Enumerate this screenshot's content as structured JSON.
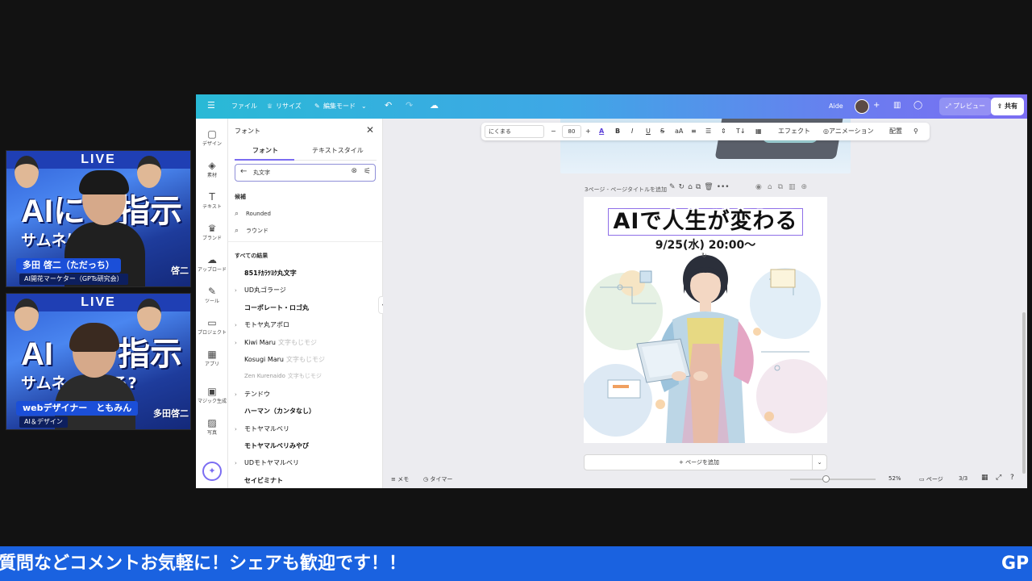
{
  "webcams": [
    {
      "live_label": "LIVE",
      "headline1": "AIに　指示",
      "headline2": "サムネは　なる?",
      "name": "多田 啓二（ただっち）",
      "role": "AI開花マーケター（GPTs研究会）",
      "side_text": "啓二"
    },
    {
      "live_label": "LIVE",
      "headline1": "AI　　指示",
      "headline2": "サムネ　　なる?",
      "name": "webデザイナー　ともみん",
      "role": "AI＆デザイン",
      "side_text": "多田啓二"
    }
  ],
  "canva": {
    "topbar": {
      "menu_icon": "menu-icon",
      "file": "ファイル",
      "resize": "リサイズ",
      "edit_mode": "編集モード",
      "user": "Aide",
      "preview": "プレビュー",
      "share": "共有"
    },
    "rail": [
      {
        "icon": "design-icon",
        "glyph": "▢",
        "label": "デザイン"
      },
      {
        "icon": "elements-icon",
        "glyph": "◈",
        "label": "素材"
      },
      {
        "icon": "text-icon",
        "glyph": "T",
        "label": "テキスト"
      },
      {
        "icon": "brand-icon",
        "glyph": "♛",
        "label": "ブランド"
      },
      {
        "icon": "upload-icon",
        "glyph": "☁",
        "label": "アップロード"
      },
      {
        "icon": "tools-icon",
        "glyph": "✎",
        "label": "ツール"
      },
      {
        "icon": "projects-icon",
        "glyph": "▭",
        "label": "プロジェクト"
      },
      {
        "icon": "apps-icon",
        "glyph": "▦",
        "label": "アプリ"
      },
      {
        "icon": "magic-media-icon",
        "glyph": "▣",
        "label": "マジック生成"
      },
      {
        "icon": "photos-icon",
        "glyph": "▨",
        "label": "写真"
      }
    ],
    "panel": {
      "title": "フォント",
      "tabs": [
        "フォント",
        "テキストスタイル"
      ],
      "search_value": "丸文字",
      "suggest_header": "候補",
      "suggestions": [
        "Rounded",
        "ラウンド"
      ],
      "results_header": "すべての結果",
      "fonts": [
        {
          "name": "851ﾁｶﾗﾂﾖｸ丸文字",
          "sample": "",
          "expand": false,
          "style": "bold"
        },
        {
          "name": "UD丸ゴラージ",
          "sample": "",
          "expand": true,
          "style": "normal"
        },
        {
          "name": "コーポレート・ロゴ丸",
          "sample": "",
          "expand": false,
          "style": "bold"
        },
        {
          "name": "モトヤ丸アポロ",
          "sample": "",
          "expand": true,
          "style": "normal"
        },
        {
          "name": "Kiwi Maru",
          "sample": "文字もじモジ",
          "expand": true,
          "style": "normal"
        },
        {
          "name": "Kosugi Maru",
          "sample": "文字もじモジ",
          "expand": false,
          "style": "normal"
        },
        {
          "name": "Zen Kurenaido",
          "sample": "文字もじモジ",
          "expand": false,
          "style": "faint"
        },
        {
          "name": "テンドウ",
          "sample": "",
          "expand": true,
          "style": "normal"
        },
        {
          "name": "ハーマン（カンタなし）",
          "sample": "",
          "expand": false,
          "style": "bold"
        },
        {
          "name": "モトヤマルベリ",
          "sample": "",
          "expand": true,
          "style": "normal"
        },
        {
          "name": "モトヤマルベリみやび",
          "sample": "",
          "expand": false,
          "style": "bold"
        },
        {
          "name": "UDモトヤマルベリ",
          "sample": "",
          "expand": true,
          "style": "normal"
        },
        {
          "name": "セイビミナト",
          "sample": "",
          "expand": false,
          "style": "bold"
        }
      ]
    },
    "context_bar": {
      "font_name": "にくまる",
      "font_size": "80",
      "effects": "エフェクト",
      "animation": "アニメーション",
      "position": "配置"
    },
    "page": {
      "header": "3ページ - ページタイトルを追加",
      "title": "AIで人生が変わる",
      "date": "9/25(水) 20:00〜"
    },
    "add_page": "+ ページを追加",
    "bottom": {
      "notes": "メモ",
      "timer": "タイマー",
      "zoom": "52%",
      "pages_label": "ページ",
      "page_count": "3/3"
    }
  },
  "ticker": {
    "message": "質問などコメントお気軽に！シェアも歓迎です！！",
    "trailing": "GP"
  },
  "colors": {
    "ticker_bg": "#1a62e0",
    "canva_gradient_start": "#29b9d6",
    "canva_gradient_end": "#7b6df2",
    "selection": "#8f6fe8"
  }
}
